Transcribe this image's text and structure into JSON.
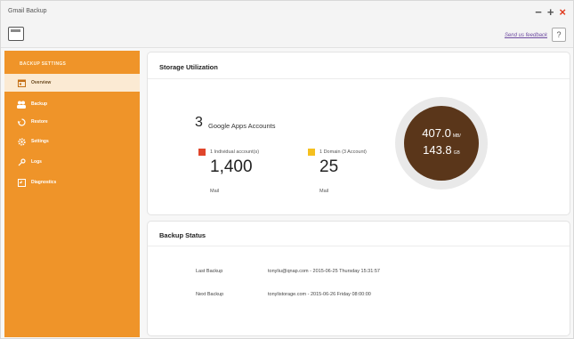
{
  "window": {
    "title": "Gmail Backup",
    "controls": {
      "minimize": "−",
      "maximize": "+",
      "close": "×"
    },
    "feedback_link": "Send us feedback",
    "help": "?"
  },
  "sidebar": {
    "header": "BACKUP SETTINGS",
    "items": [
      {
        "label": "Overview",
        "icon": "calendar-icon",
        "active": true
      },
      {
        "label": "Backup",
        "icon": "people-icon",
        "active": false
      },
      {
        "label": "Restore",
        "icon": "restore-icon",
        "active": false
      },
      {
        "label": "Settings",
        "icon": "gear-icon",
        "active": false
      },
      {
        "label": "Logs",
        "icon": "key-icon",
        "active": false
      },
      {
        "label": "Diagnostics",
        "icon": "diagnostics-icon",
        "active": false
      }
    ]
  },
  "storage": {
    "title": "Storage Utilization",
    "account_count": "3",
    "account_label": "Google Apps Accounts",
    "individual": {
      "legend": "1 Individual account(s)",
      "value": "1,400",
      "unit": "Mail",
      "color": "#e0452b"
    },
    "domain": {
      "legend": "1 Domain (3 Account)",
      "value": "25",
      "unit": "Mail",
      "color": "#f5c01f"
    },
    "gauge": {
      "used": "407.0",
      "used_unit": "MB/",
      "total": "143.8",
      "total_unit": "GB"
    }
  },
  "backup_status": {
    "title": "Backup Status",
    "last_label": "Last Backup",
    "last_value": "tonyliu@qnap.com - 2015-06-25 Thursday 15:31:57",
    "next_label": "Next Backup",
    "next_value": "tonylistorage.com - 2015-06-26 Friday 08:00:00"
  }
}
